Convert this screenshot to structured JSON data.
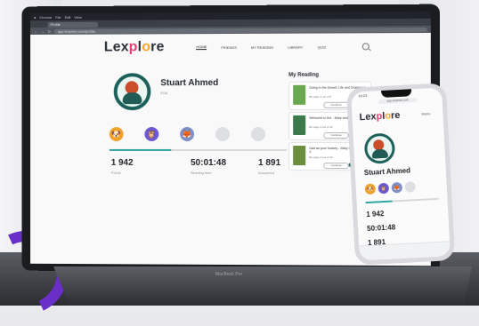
{
  "app": {
    "logo": {
      "prefix": "Lex",
      "p": "p",
      "l": "l",
      "o": "o",
      "suffix": "re"
    },
    "browser_tab": "Profile",
    "url": "app.lexplore.com/profile",
    "nav": [
      "HOME",
      "FRIENDS",
      "MY READING",
      "LIBRARY",
      "QUIZ"
    ],
    "profile_name": "Stuart Ahmed",
    "profile_sub": "FO4",
    "stats": [
      {
        "value": "1 942",
        "label": "Points"
      },
      {
        "value": "50:01:48",
        "label": "Reading time"
      },
      {
        "value": "1 891",
        "label": "Answered"
      }
    ],
    "my_reading_title": "My Reading",
    "books": [
      {
        "title": "Doing in the Desert: Life and Drawing 1",
        "meta": "Bo page 3 out of 8",
        "btn_resume": "Continue",
        "btn_open": "Open",
        "cover": "#6aa84f"
      },
      {
        "title": "Welcome to the - Mary and Trevor 1",
        "meta": "Bo page 3 out of 16",
        "btn_resume": "Continue",
        "btn_open": "Open",
        "cover": "#3d7a4b"
      },
      {
        "title": "Dad as your hockey - Mary and Trevor 3",
        "meta": "Bo page 4 out of 16",
        "btn_resume": "Continue",
        "btn_open": "Open",
        "cover": "#6b8f3d"
      }
    ]
  },
  "phone": {
    "status_time": "10:23",
    "url": "app.lexplore.com",
    "menu": "Menu",
    "profile_name": "Stuart Ahmed",
    "stats": [
      "1 942",
      "50:01:48",
      "1 891"
    ]
  },
  "laptop_label": "MacBook Pro"
}
